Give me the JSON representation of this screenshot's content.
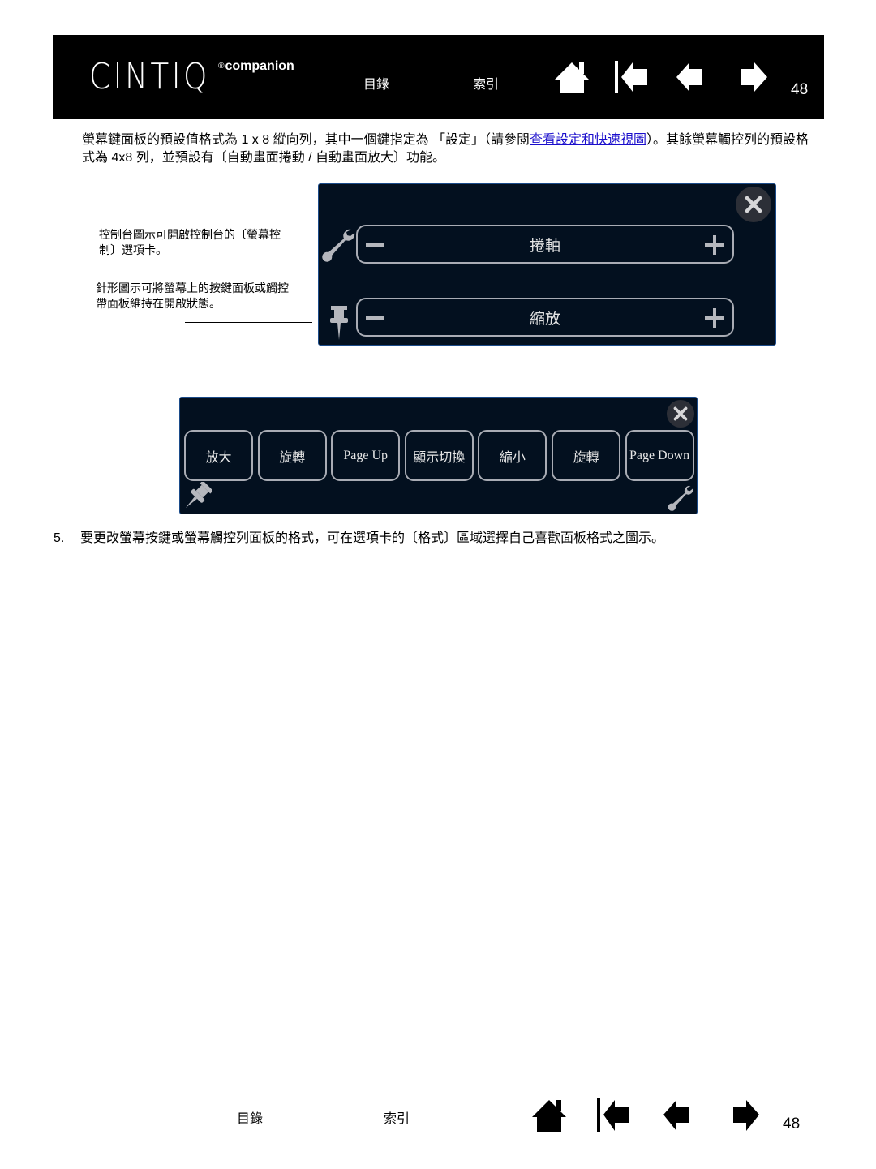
{
  "header": {
    "logo_main": "CINTIQ",
    "logo_mark": "®",
    "logo_sub": "companion",
    "toc_label": "目錄",
    "index_label": "索引",
    "nav_icons": [
      "home-icon",
      "first-page-icon",
      "previous-page-icon",
      "next-page-icon"
    ],
    "page_number": "48"
  },
  "intro": {
    "text_before_link": "螢幕鍵面板的預設值格式為 1 x 8 縱向列，其中一個鍵指定為 「設定」（請參閱",
    "link_text": "查看設定和快速視圖",
    "text_after_link": "）。其餘螢幕觸控列的預設格式為 4x8 列，並預設有〔自動畫面捲動 / 自動畫面放大〕功能。"
  },
  "callouts": {
    "settings_icon": "控制台圖示可開啟控制台的〔螢幕控制〕選項卡。",
    "pin_icon": "針形圖示可將螢幕上的按鍵面板或觸控帶面板維持在開啟狀態。"
  },
  "strip_panel": {
    "rows": [
      {
        "label": "捲軸",
        "minus": "−",
        "plus": "+"
      },
      {
        "label": "縮放",
        "minus": "−",
        "plus": "+"
      }
    ],
    "close_icon": "close-icon",
    "settings_icon": "wrench-icon",
    "pin_icon": "pin-icon"
  },
  "grid_panel": {
    "keys": [
      "放大",
      "旋轉",
      "Page Up",
      "顯示切換",
      "縮小",
      "旋轉",
      "Page Down"
    ],
    "close_icon": "close-icon",
    "settings_icon": "wrench-icon",
    "pin_icon": "pin-icon"
  },
  "step": {
    "number": "5.",
    "text": "要更改螢幕按鍵或螢幕觸控列面板的格式，可在選項卡的〔格式〕區域選擇自己喜歡面板格式之圖示。"
  },
  "footer": {
    "toc_label": "目錄",
    "index_label": "索引",
    "page_number": "48"
  },
  "colors": {
    "header_bg": "#000000",
    "panel_bg": "#03101f",
    "panel_border": "#1c4c8a",
    "link": "#1a0dcc"
  }
}
